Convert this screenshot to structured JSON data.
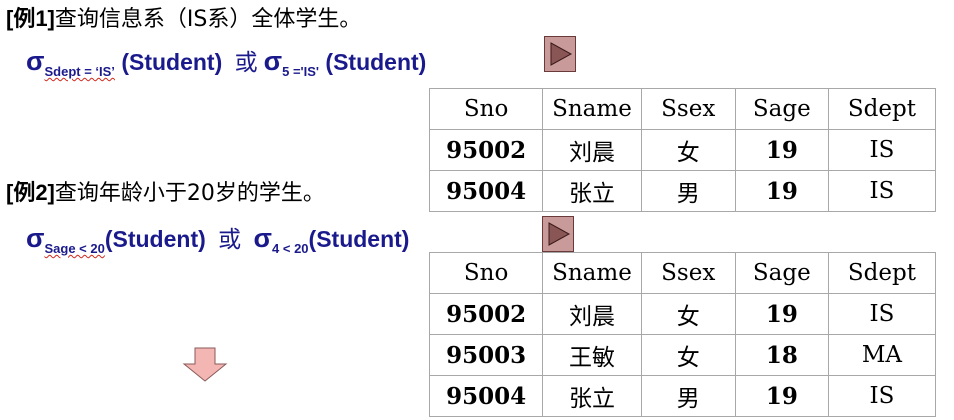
{
  "example1": {
    "tag": "[例1]",
    "text": "查询信息系（IS系）全体学生。",
    "formula": {
      "sigma": "σ",
      "cond_sub": "Sdept = ‘IS’",
      "arg": "(Student)",
      "or": "或",
      "cond_sub2": "5 ='IS'",
      "arg2": "(Student)"
    },
    "table": {
      "headers": [
        "Sno",
        "Sname",
        "Ssex",
        "Sage",
        "Sdept"
      ],
      "rows": [
        [
          "95002",
          "刘晨",
          "女",
          "19",
          "IS"
        ],
        [
          "95004",
          "张立",
          "男",
          "19",
          "IS"
        ]
      ]
    }
  },
  "example2": {
    "tag": "[例2]",
    "text": "查询年龄小于20岁的学生。",
    "formula": {
      "sigma": "σ",
      "cond_sub": "Sage < 20",
      "arg": "(Student)",
      "or": "或",
      "cond_sub2": "4 < 20",
      "arg2": "(Student)"
    },
    "table": {
      "headers": [
        "Sno",
        "Sname",
        "Ssex",
        "Sage",
        "Sdept"
      ],
      "rows": [
        [
          "95002",
          "刘晨",
          "女",
          "19",
          "IS"
        ],
        [
          "95003",
          "王敏",
          "女",
          "18",
          "MA"
        ],
        [
          "95004",
          "张立",
          "男",
          "19",
          "IS"
        ]
      ]
    }
  },
  "icons": {
    "play1": "play-icon",
    "play2": "play-icon",
    "down": "down-arrow-icon"
  },
  "colors": {
    "formula": "#1a1a8c",
    "button_fill": "#c99a9a",
    "arrow_fill": "#f4b6b2"
  }
}
